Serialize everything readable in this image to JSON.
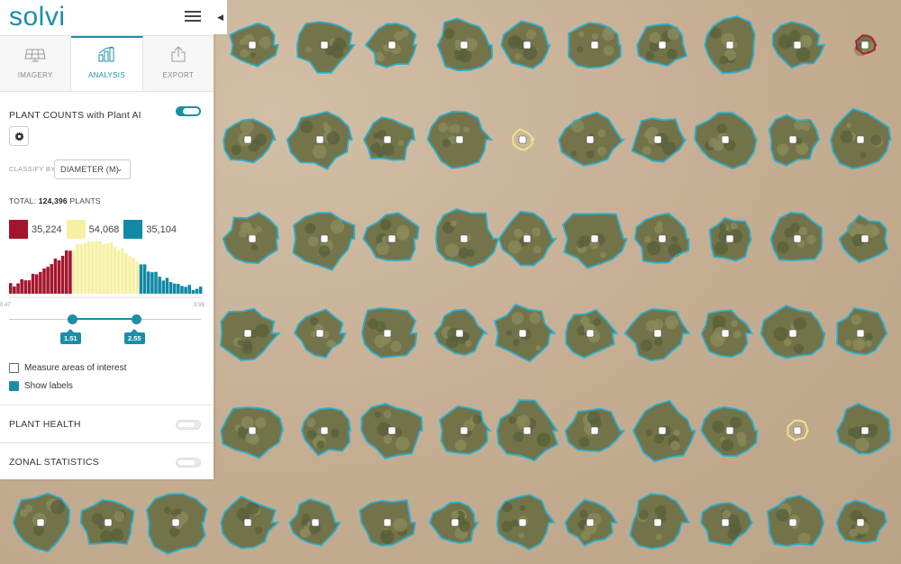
{
  "app": {
    "logo": "solvi"
  },
  "tabs": [
    {
      "label": "IMAGERY",
      "icon": "solar-panel-icon",
      "active": false
    },
    {
      "label": "ANALYSIS",
      "icon": "analysis-chart-icon",
      "active": true
    },
    {
      "label": "EXPORT",
      "icon": "export-icon",
      "active": false
    }
  ],
  "plant_counts": {
    "title": "PLANT COUNTS with Plant AI",
    "enabled": true,
    "classify_label": "CLASSIFY BY",
    "classify_value": "DIAMETER (M)",
    "total_prefix": "TOTAL:",
    "total_count": "124,396",
    "total_suffix": "PLANTS",
    "classes": [
      {
        "color": "#a4152c",
        "count": "35,224"
      },
      {
        "color": "#f6f0a3",
        "count": "54,068"
      },
      {
        "color": "#1289a6",
        "count": "35,104"
      }
    ],
    "axis_min": "0.47",
    "axis_max": "3.59",
    "threshold_low": "1.51",
    "threshold_high": "2.55",
    "measure_areas_label": "Measure areas of interest",
    "measure_areas_checked": false,
    "show_labels_label": "Show labels",
    "show_labels_checked": true
  },
  "plant_health": {
    "title": "PLANT HEALTH",
    "enabled": false
  },
  "zonal_statistics": {
    "title": "ZONAL STATISTICS",
    "enabled": false
  },
  "colors": {
    "accent": "#1a8fa8",
    "outline": "#2ab0cf",
    "highlight": "#f0e88a",
    "small": "#b01830"
  }
}
